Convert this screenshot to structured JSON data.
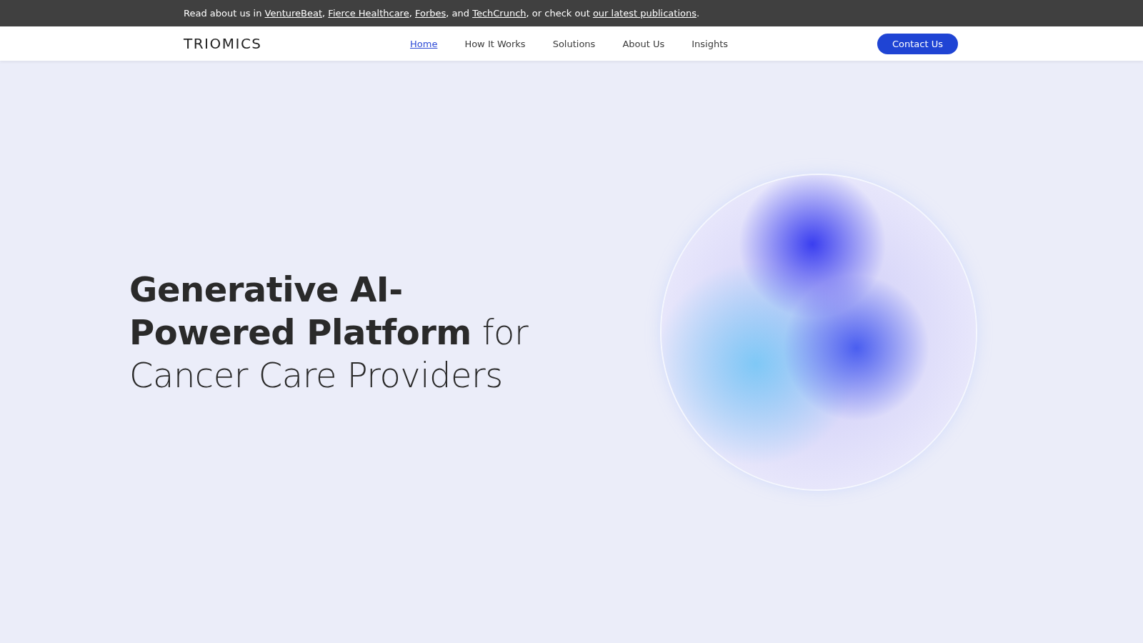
{
  "announcement": [
    {
      "kind": "text",
      "text": "Read about us in "
    },
    {
      "kind": "link",
      "text": "VentureBeat"
    },
    {
      "kind": "text",
      "text": ", "
    },
    {
      "kind": "link",
      "text": "Fierce Healthcare"
    },
    {
      "kind": "text",
      "text": ", "
    },
    {
      "kind": "link",
      "text": "Forbes"
    },
    {
      "kind": "text",
      "text": ", and "
    },
    {
      "kind": "link",
      "text": "TechCrunch"
    },
    {
      "kind": "text",
      "text": ", or check out "
    },
    {
      "kind": "link",
      "text": "our latest publications"
    },
    {
      "kind": "text",
      "text": "."
    }
  ],
  "logo": "TRIOMICS",
  "nav": [
    {
      "label": "Home",
      "selected": true
    },
    {
      "label": "How It Works",
      "selected": false
    },
    {
      "label": "Solutions",
      "selected": false
    },
    {
      "label": "About Us",
      "selected": false
    },
    {
      "label": "Insights",
      "selected": false
    }
  ],
  "cta": "Contact Us",
  "hero": {
    "headline": "**Generative AI-Powered Platform** for Cancer Care Providers"
  }
}
